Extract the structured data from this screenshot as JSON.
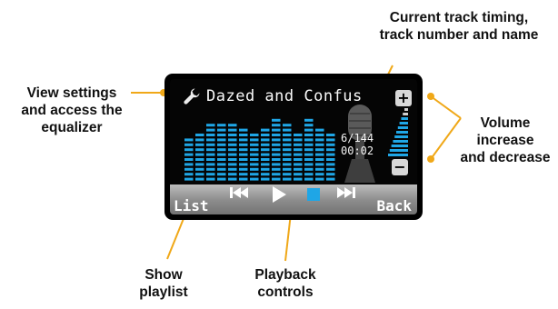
{
  "callouts": {
    "settings": [
      "View settings",
      "and access the",
      "equalizer"
    ],
    "track": [
      "Current track timing,",
      "track number and name"
    ],
    "volume": [
      "Volume",
      "increase",
      "and decrease"
    ],
    "playlist": [
      "Show",
      "playlist"
    ],
    "playback": [
      "Playback",
      "controls"
    ]
  },
  "player": {
    "track_name": "Dazed and Confus",
    "track_number": "6/144",
    "time": "00:02",
    "list_label": "List",
    "back_label": "Back",
    "vol_plus": "+",
    "vol_minus": "−"
  },
  "colors": {
    "eq_bar": "#1fa6e6",
    "leader_line": "#f0a818",
    "stop_button": "#1fa6e6"
  },
  "icons": [
    "wrench-icon",
    "microphone-icon",
    "previous-icon",
    "play-icon",
    "stop-icon",
    "next-icon"
  ]
}
